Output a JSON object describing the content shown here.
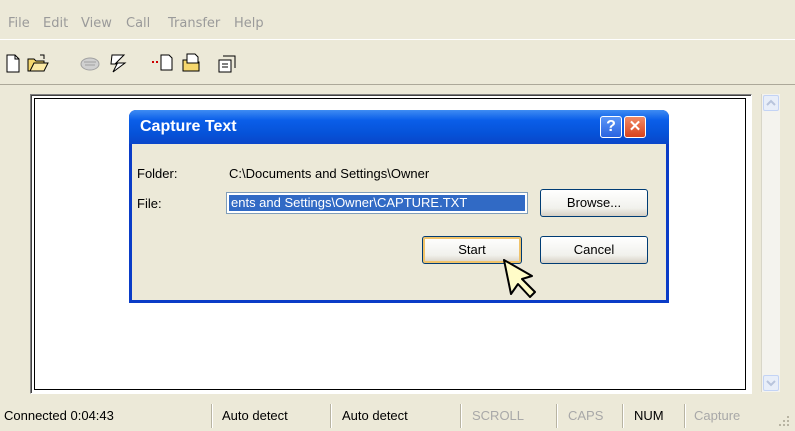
{
  "menu": [
    "File",
    "Edit",
    "View",
    "Call",
    "Transfer",
    "Help"
  ],
  "toolbar_icons": [
    "new-file-icon",
    "open-folder-icon",
    "disconnect-phone-icon",
    "call-icon",
    "send-file-icon",
    "receive-file-icon",
    "properties-icon"
  ],
  "dialog": {
    "title": "Capture Text",
    "folder_label": "Folder:",
    "folder_value": "C:\\Documents and Settings\\Owner",
    "file_label": "File:",
    "file_value": "ents and Settings\\Owner\\CAPTURE.TXT",
    "browse_label": "Browse...",
    "start_label": "Start",
    "cancel_label": "Cancel",
    "help_glyph": "?",
    "close_glyph": "✕"
  },
  "status": {
    "connected": "Connected 0:04:43",
    "detect1": "Auto detect",
    "detect2": "Auto detect",
    "scroll": "SCROLL",
    "caps": "CAPS",
    "num": "NUM",
    "capture": "Capture"
  },
  "colors": {
    "title_bar": "#0a5ee9",
    "close_button": "#d8421c",
    "selection": "#316ac5",
    "window_bg": "#ece9d8"
  }
}
